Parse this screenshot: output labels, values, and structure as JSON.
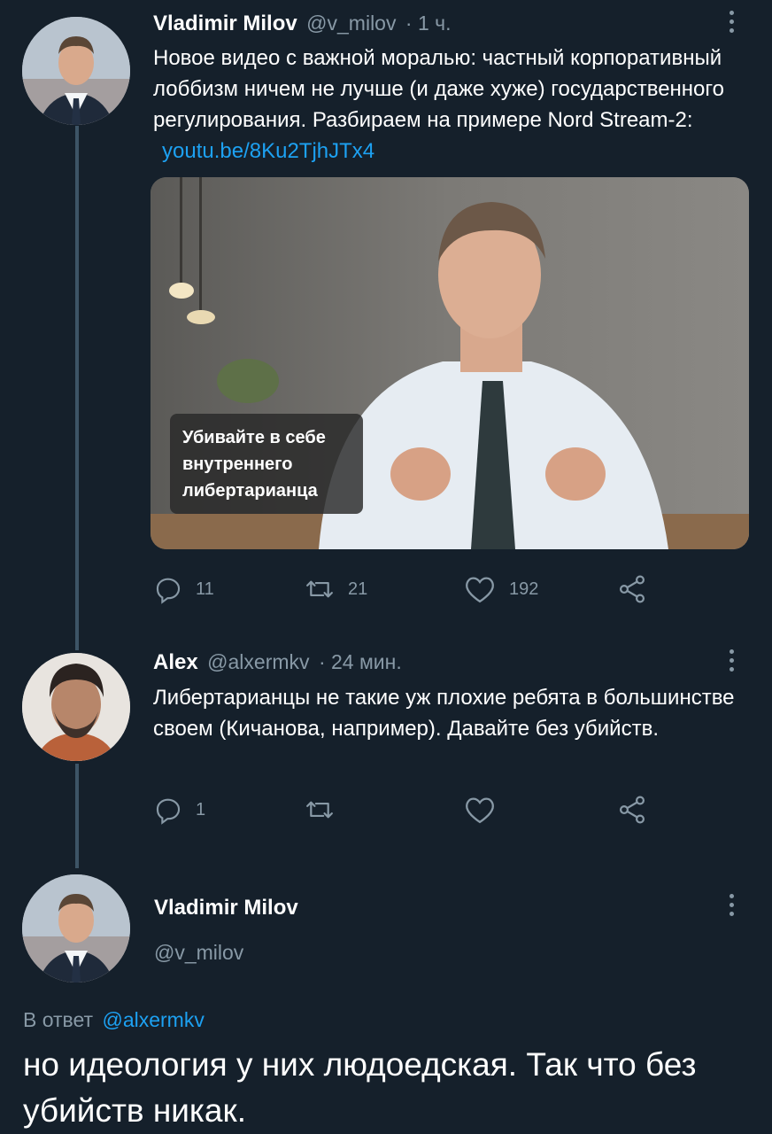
{
  "tweets": [
    {
      "author": "Vladimir Milov",
      "handle": "@v_milov",
      "time": "· 1 ч.",
      "text_before_link": "Новое видео с важной моралью: частный корпоративный лоббизм ничем не лучше (и даже хуже) государственного регулирования. Разбираем на примере Nord Stream-2:",
      "link": "youtu.be/8Ku2TjhJTx4",
      "media_caption": "Убивайте в себе внутреннего либертарианца",
      "reply_count": "11",
      "retweet_count": "21",
      "like_count": "192"
    },
    {
      "author": "Alex",
      "handle": "@alxermkv",
      "time": "· 24 мин.",
      "text": "Либертарианцы не такие уж плохие ребята в большинстве своем (Кичанова, например). Давайте без убийств.",
      "reply_count": "1",
      "retweet_count": "",
      "like_count": ""
    }
  ],
  "focused": {
    "author": "Vladimir Milov",
    "handle": "@v_milov",
    "reply_prefix": "В ответ",
    "reply_to": "@alxermkv",
    "text": "но идеология у них людоедская. Так что без убийств никак."
  },
  "icons": {
    "reply": "reply-icon",
    "retweet": "retweet-icon",
    "like": "heart-icon",
    "share": "share-icon",
    "more": "more-dots-icon"
  },
  "colors": {
    "background": "#15202b",
    "text": "#ffffff",
    "secondary": "#8899a6",
    "link": "#1da1f2"
  }
}
